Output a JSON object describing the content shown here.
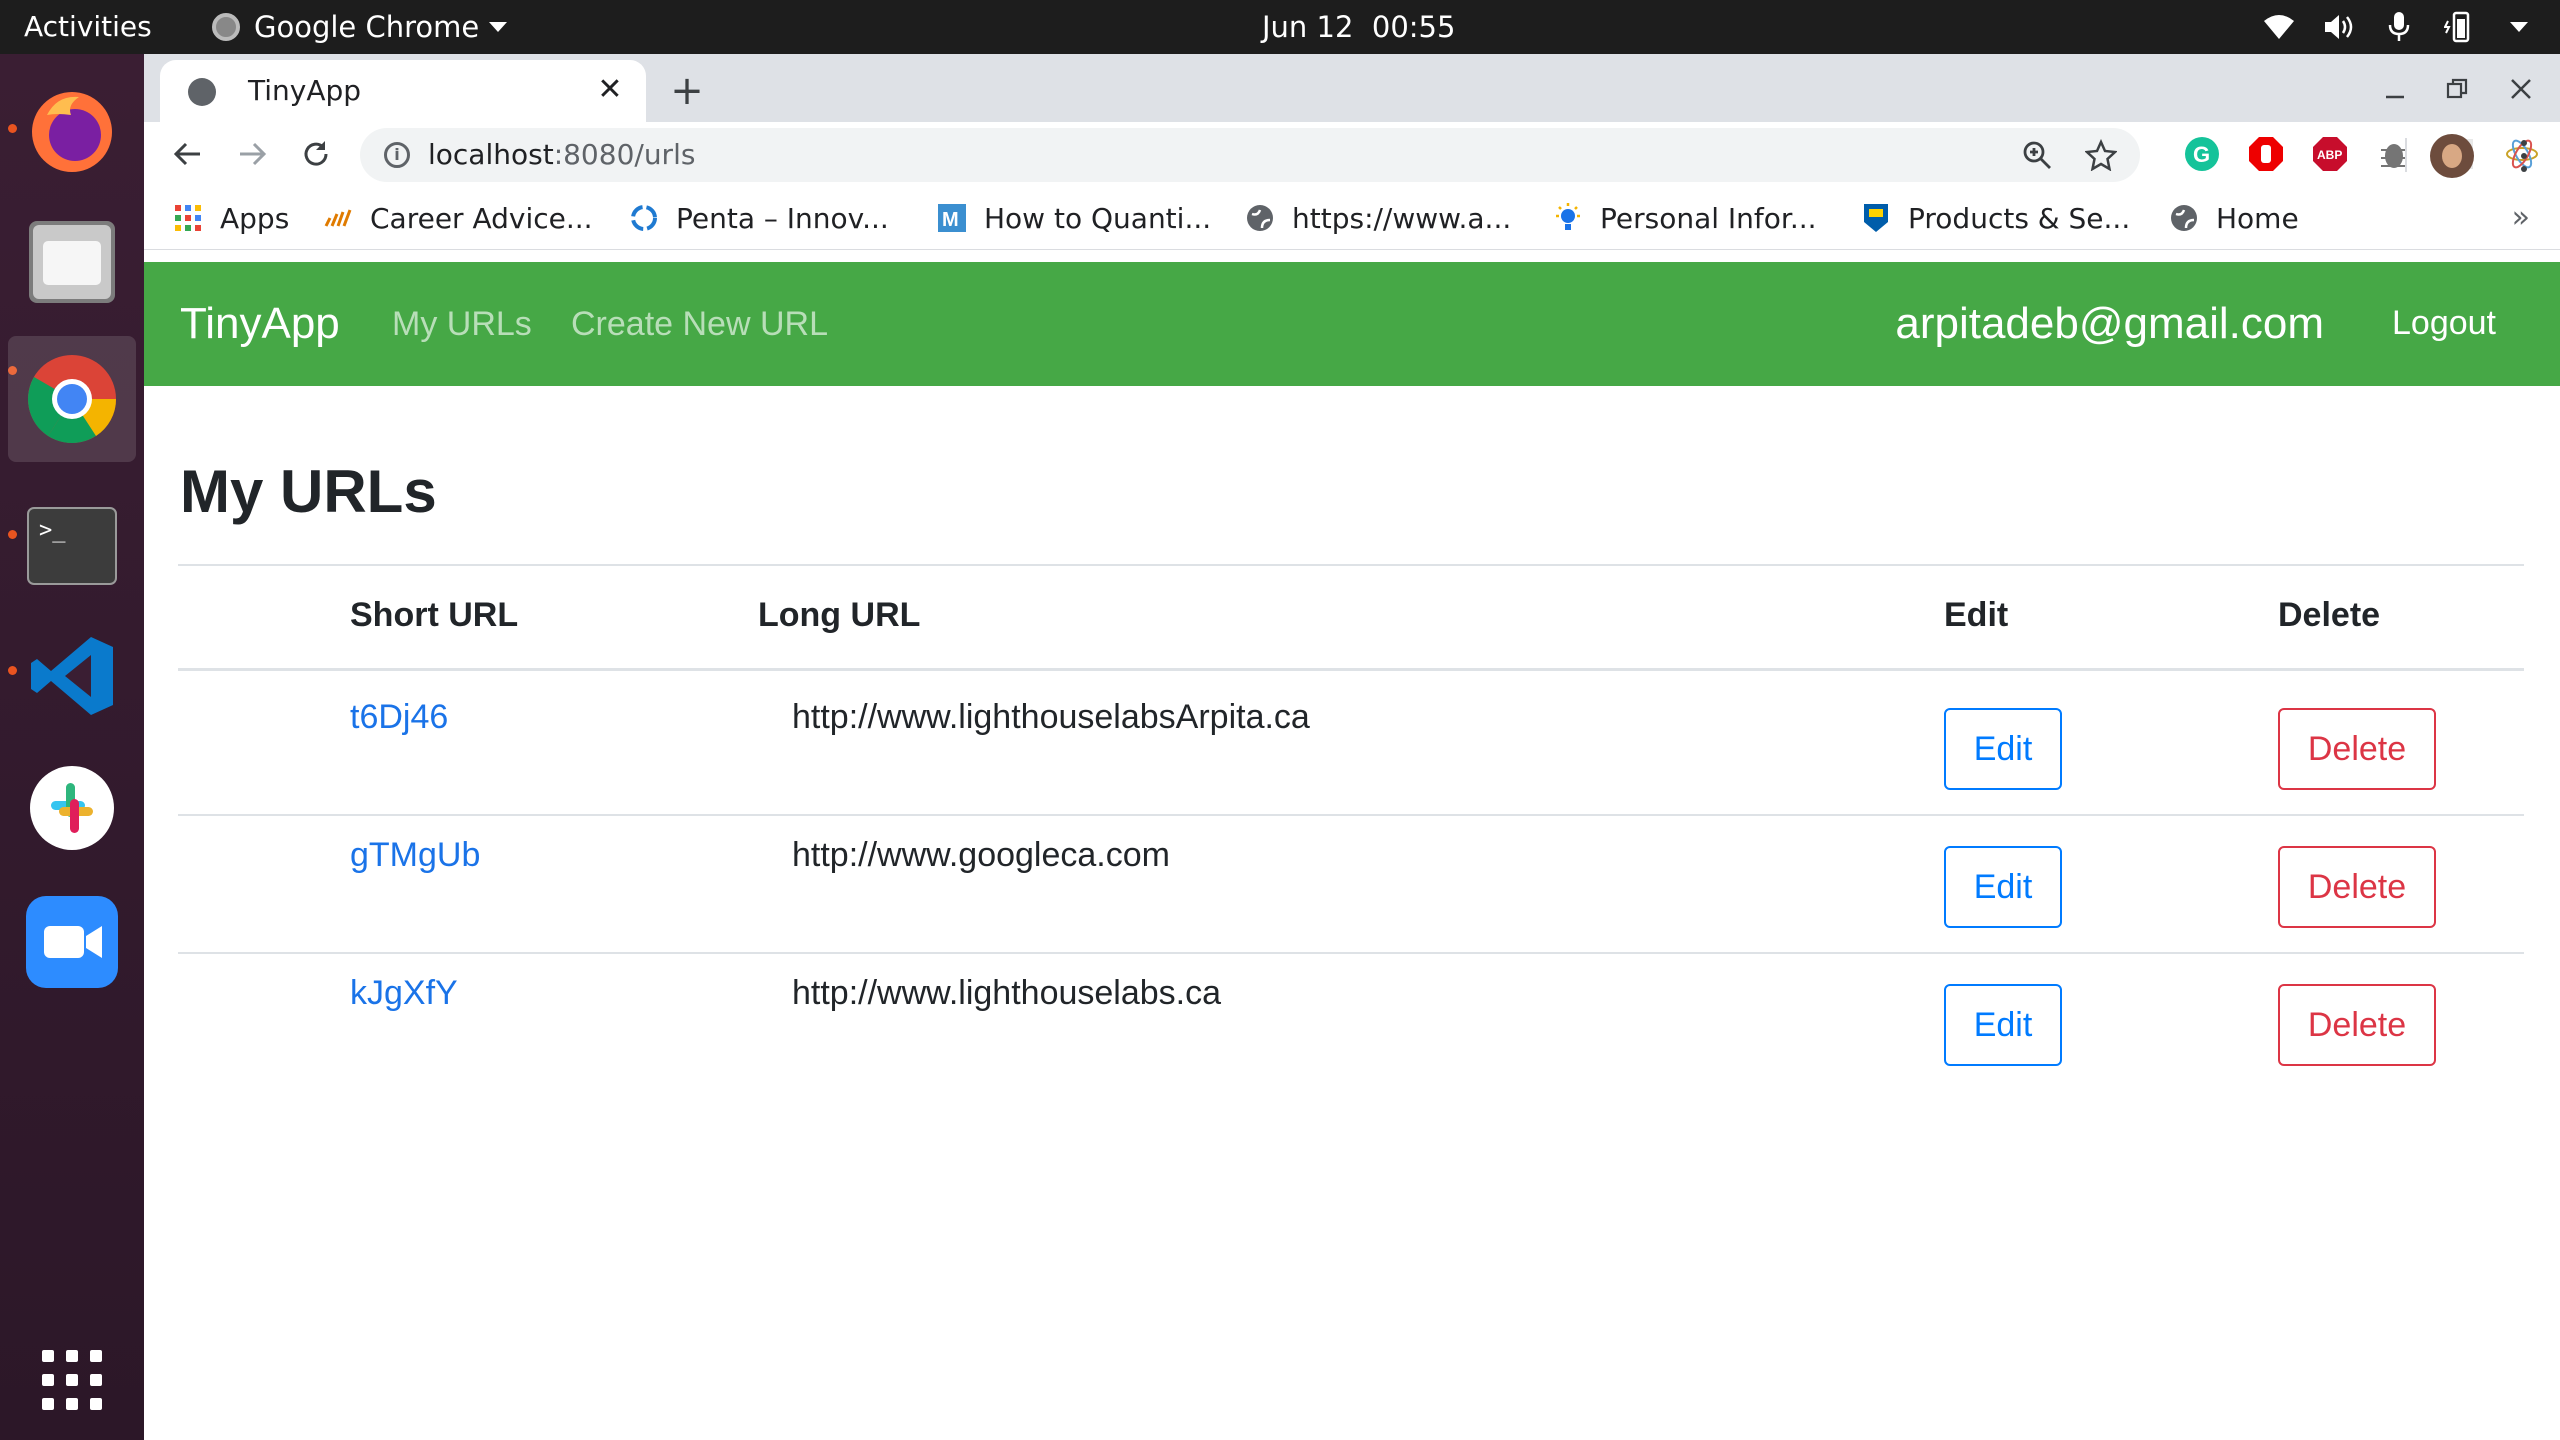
{
  "system_bar": {
    "activities": "Activities",
    "app_name": "Google Chrome",
    "clock": "Jun 12  00:55"
  },
  "dock": {
    "apps": [
      "firefox-icon",
      "files-icon",
      "chrome-icon",
      "terminal-icon",
      "vscode-icon",
      "slack-icon",
      "zoom-icon",
      "app-grid-icon"
    ]
  },
  "browser": {
    "tab_title": "TinyApp",
    "url_host": "localhost",
    "url_path": ":8080/urls",
    "bookmarks": [
      {
        "label": "Apps",
        "icon": "apps-grid-icon"
      },
      {
        "label": "Career Advice...",
        "icon": "career-icon"
      },
      {
        "label": "Penta – Innov...",
        "icon": "penta-icon"
      },
      {
        "label": "How to Quanti...",
        "icon": "medium-icon"
      },
      {
        "label": "https://www.a...",
        "icon": "globe-icon"
      },
      {
        "label": "Personal Infor...",
        "icon": "bulb-icon"
      },
      {
        "label": "Products & Se...",
        "icon": "rbc-icon"
      },
      {
        "label": "Home",
        "icon": "globe-icon"
      }
    ],
    "bookmarks_more": "»"
  },
  "app": {
    "brand": "TinyApp",
    "nav": {
      "my_urls": "My URLs",
      "create": "Create New URL"
    },
    "user_email": "arpitadeb@gmail.com",
    "logout": "Logout",
    "page_title": "My URLs",
    "table": {
      "headers": {
        "short": "Short URL",
        "long": "Long URL",
        "edit": "Edit",
        "delete": "Delete"
      },
      "rows": [
        {
          "short": "t6Dj46",
          "long": "http://www.lighthouselabsArpita.ca",
          "edit": "Edit",
          "delete": "Delete"
        },
        {
          "short": "gTMgUb",
          "long": "http://www.googleca.com",
          "edit": "Edit",
          "delete": "Delete"
        },
        {
          "short": "kJgXfY",
          "long": "http://www.lighthouselabs.ca",
          "edit": "Edit",
          "delete": "Delete"
        }
      ]
    }
  },
  "colors": {
    "navbar": "#46a846",
    "link": "#1a73e8",
    "edit_button": "#007bff",
    "delete_button": "#dc3545",
    "ubuntu_accent": "#e95420"
  }
}
